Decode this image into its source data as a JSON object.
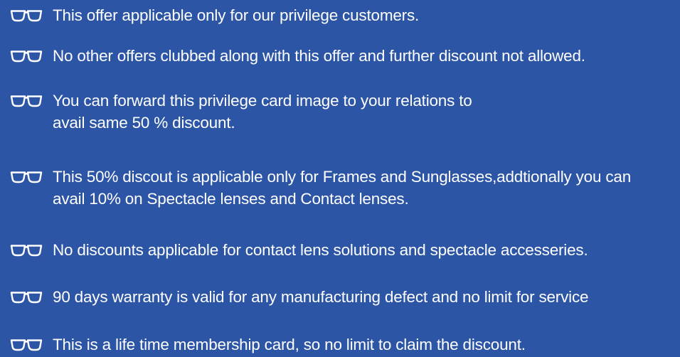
{
  "terms": [
    {
      "icon": "glasses-icon",
      "lines": [
        "This offer applicable only for our privilege customers."
      ]
    },
    {
      "icon": "glasses-icon",
      "lines": [
        "No other offers clubbed along with this offer and further discount not allowed."
      ]
    },
    {
      "icon": "glasses-icon",
      "lines": [
        "You can forward this privilege card image to your relations to",
        "avail same 50 % discount."
      ]
    },
    {
      "icon": "glasses-icon",
      "lines": [
        "This 50% discout is applicable only for Frames and Sunglasses,addtionally you can",
        "avail 10% on Spectacle lenses and Contact lenses."
      ]
    },
    {
      "icon": "glasses-icon",
      "lines": [
        "No discounts applicable for contact lens solutions and spectacle accesseries."
      ]
    },
    {
      "icon": "glasses-icon",
      "lines": [
        "90 days warranty is valid for any manufacturing defect and no limit for service"
      ]
    },
    {
      "icon": "glasses-icon",
      "lines": [
        "This is a life time membership card, so no limit to claim the discount."
      ]
    }
  ],
  "colors": {
    "background": "#2c55a6",
    "text": "#ffffff"
  }
}
